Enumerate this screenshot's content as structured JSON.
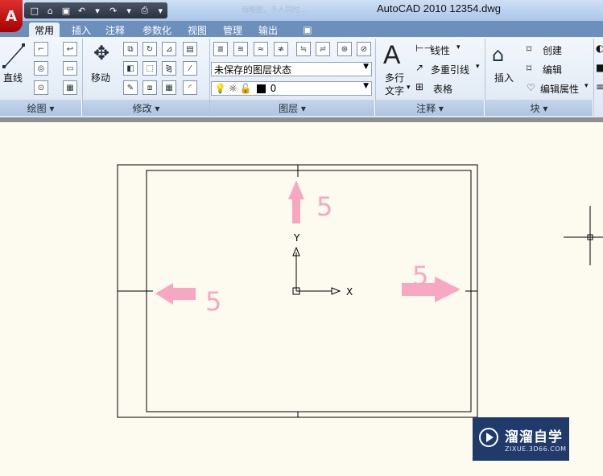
{
  "window": {
    "title": "AutoCAD 2010      12354.dwg",
    "blurred_doc": "缩略图，千人同时…",
    "logo": "A"
  },
  "qat": {
    "icons": [
      "new-icon",
      "open-icon",
      "save-icon",
      "undo-icon",
      "redo-icon",
      "print-icon"
    ]
  },
  "tabs": [
    "常用",
    "插入",
    "注释",
    "参数化",
    "视图",
    "管理",
    "输出"
  ],
  "tab_extra_icon": "▣",
  "ribbon": {
    "draw": {
      "line_label": "直线",
      "footer": "绘图 ▾"
    },
    "modify": {
      "move_label": "移动",
      "footer": "修改 ▾"
    },
    "layers": {
      "state_combo": "未保存的图层状态",
      "layer_combo": "0",
      "footer": "图层 ▾"
    },
    "annotation": {
      "mtext_label_1": "多行",
      "mtext_label_2": "文字",
      "linear": "线性",
      "multileader": "多重引线",
      "table": "表格",
      "footer": "注释 ▾"
    },
    "block": {
      "insert": "插入",
      "create": "创建",
      "edit": "编辑",
      "edit_attr": "编辑属性",
      "footer": "块 ▾"
    }
  },
  "drawing": {
    "arrow_value_top": "5",
    "arrow_value_left": "5",
    "arrow_value_right": "5",
    "ucs_x": "X",
    "ucs_y": "Y",
    "accent_color": "#f7a8c0"
  },
  "watermark": {
    "name": "溜溜自学",
    "url": "ZIXUE.3D66.COM"
  }
}
